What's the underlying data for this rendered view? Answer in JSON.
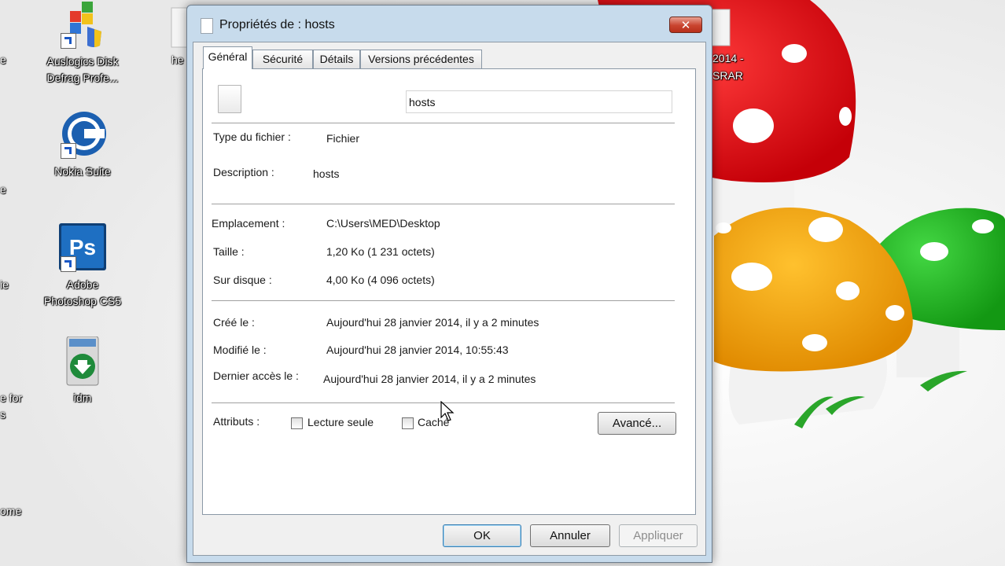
{
  "desktop": {
    "icons": [
      {
        "label_line1": "Auslogics Disk",
        "label_line2": "Defrag Profe...",
        "icon": "auslogics-icon"
      },
      {
        "label_line1": "Nokia Suite",
        "icon": "nokia-suite-icon"
      },
      {
        "label_line1": "Adobe",
        "label_line2": "Photoshop CS5",
        "icon": "photoshop-icon"
      },
      {
        "label_line1": "idm",
        "icon": "idm-icon"
      }
    ],
    "behind_icon_text": "he",
    "right_icon_line1": "2014 -",
    "right_icon_line2": "SRAR",
    "left_edge": [
      "e",
      "e",
      "ie",
      "e",
      "s",
      "e for",
      "s",
      "ome"
    ]
  },
  "dialog": {
    "title": "Propriétés de : hosts",
    "close_glyph": "✕",
    "tabs": [
      "Général",
      "Sécurité",
      "Détails",
      "Versions précédentes"
    ],
    "active_tab": "Général",
    "file_name": "hosts",
    "general": {
      "type_label": "Type du fichier :",
      "type_value": "Fichier",
      "description_label": "Description :",
      "description_value": "hosts",
      "location_label": "Emplacement :",
      "location_value": "C:\\Users\\MED\\Desktop",
      "size_label": "Taille :",
      "size_value": "1,20 Ko (1 231 octets)",
      "disk_label": "Sur disque :",
      "disk_value": "4,00 Ko (4 096 octets)",
      "created_label": "Créé le :",
      "created_value": "Aujourd'hui 28 janvier 2014, il y a 2 minutes",
      "modified_label": "Modifié le :",
      "modified_value": "Aujourd'hui 28 janvier 2014, 10:55:43",
      "accessed_label": "Dernier accès le :",
      "accessed_value": "Aujourd'hui 28 janvier 2014, il y a 2 minutes",
      "attributes_label": "Attributs :",
      "readonly_label": "Lecture seule",
      "readonly_checked": false,
      "hidden_label": "Caché",
      "hidden_checked": false,
      "advanced_button": "Avancé..."
    },
    "buttons": {
      "ok": "OK",
      "cancel": "Annuler",
      "apply": "Appliquer"
    }
  },
  "colors": {
    "dialog_frame": "#c7dbec",
    "close_button": "#c9442f",
    "mushroom_red": "#e8101a",
    "mushroom_orange": "#f5a300",
    "mushroom_green": "#1fb31f"
  }
}
